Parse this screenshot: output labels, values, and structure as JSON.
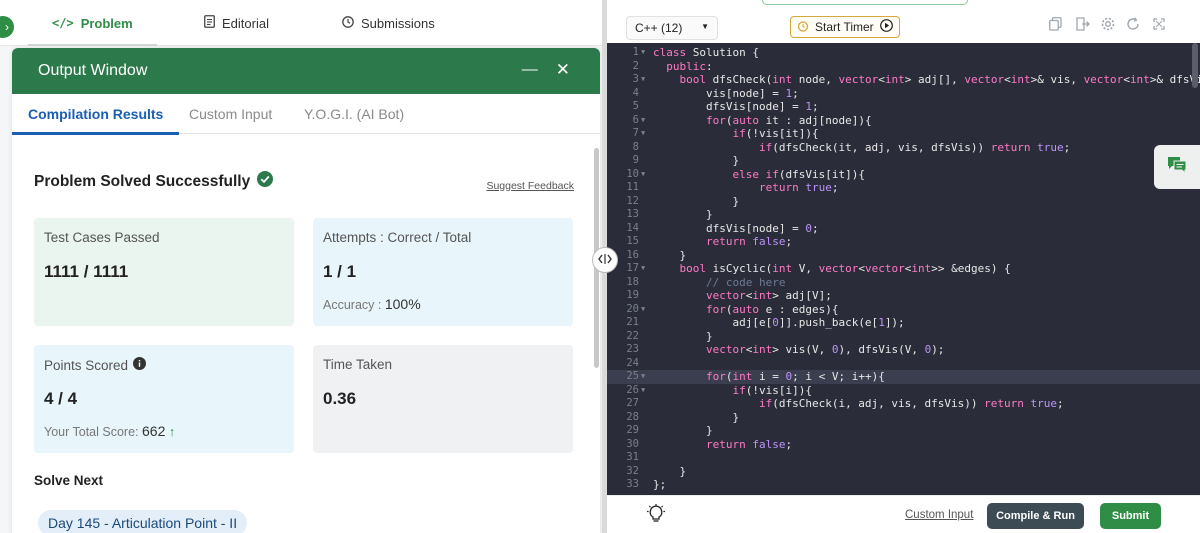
{
  "nav": {
    "tabs": [
      {
        "label": "Problem",
        "icon": "code-icon"
      },
      {
        "label": "Editorial",
        "icon": "document-icon"
      },
      {
        "label": "Submissions",
        "icon": "clock-icon"
      }
    ],
    "collapse_icon": "›"
  },
  "output": {
    "title": "Output Window",
    "minimize": "—",
    "close": "✕",
    "tabs": [
      "Compilation Results",
      "Custom Input",
      "Y.O.G.I. (AI Bot)"
    ],
    "result_title": "Problem Solved Successfully",
    "feedback_link": "Suggest Feedback",
    "cards": {
      "tests": {
        "label": "Test Cases Passed",
        "value": "1111 / 1111"
      },
      "attempts": {
        "label": "Attempts : Correct / Total",
        "value": "1 / 1",
        "accuracy_label": "Accuracy :",
        "accuracy_value": "100%"
      },
      "points": {
        "label": "Points Scored",
        "value": "4 / 4",
        "total_label": "Your Total Score:",
        "total_value": "662"
      },
      "time": {
        "label": "Time Taken",
        "value": "0.36"
      }
    },
    "solve_next_title": "Solve Next",
    "next_problem": "Day 145 - Articulation Point - II"
  },
  "editor": {
    "language": "C++ (12)",
    "timer_label": "Start Timer",
    "active_line": 25,
    "custom_input_link": "Custom Input",
    "compile_button": "Compile & Run",
    "submit_button": "Submit",
    "lines": [
      "class Solution {",
      "  public:",
      "    bool dfsCheck(int node, vector<int> adj[], vector<int>& vis, vector<int>& dfsVis){",
      "        vis[node] = 1;",
      "        dfsVis[node] = 1;",
      "        for(auto it : adj[node]){",
      "            if(!vis[it]){",
      "                if(dfsCheck(it, adj, vis, dfsVis)) return true;",
      "            }",
      "            else if(dfsVis[it]){",
      "                return true;",
      "            }",
      "        }",
      "        dfsVis[node] = 0;",
      "        return false;",
      "    }",
      "    bool isCyclic(int V, vector<vector<int>> &edges) {",
      "        // code here",
      "        vector<int> adj[V];",
      "        for(auto e : edges){",
      "            adj[e[0]].push_back(e[1]);",
      "        }",
      "        vector<int> vis(V, 0), dfsVis(V, 0);",
      "",
      "        for(int i = 0; i < V; i++){",
      "            if(!vis[i]){",
      "                if(dfsCheck(i, adj, vis, dfsVis)) return true;",
      "            }",
      "        }",
      "        return false;",
      "",
      "    }",
      "};"
    ],
    "fold_lines": [
      1,
      3,
      6,
      7,
      10,
      17,
      20,
      25,
      26
    ]
  },
  "colors": {
    "brand_green": "#2f8d46",
    "output_header": "#2c7a4b",
    "editor_bg": "#2a2d39",
    "tab_blue": "#1a5fb4",
    "card_green": "#e9f5ee",
    "card_blue": "#e8f6fb"
  }
}
